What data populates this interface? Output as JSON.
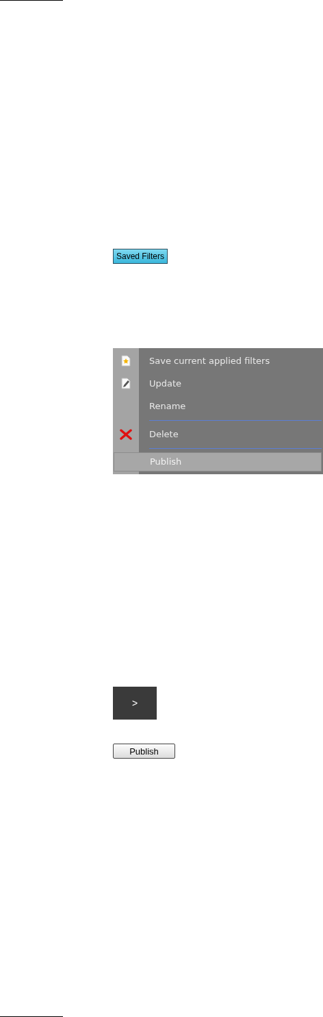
{
  "saved_filters_button": {
    "label": "Saved Filters"
  },
  "menu": {
    "items": [
      {
        "kind": "item",
        "label": "Save current applied filters",
        "selected": false
      },
      {
        "kind": "item",
        "label": "Update",
        "selected": false
      },
      {
        "kind": "item",
        "label": "Rename",
        "selected": false
      },
      {
        "kind": "separator"
      },
      {
        "kind": "item",
        "label": "Delete",
        "selected": false
      },
      {
        "kind": "separator"
      },
      {
        "kind": "item",
        "label": "Publish",
        "selected": true
      }
    ]
  },
  "next_button": {
    "label": ">"
  },
  "publish_button": {
    "label": "Publish"
  }
}
